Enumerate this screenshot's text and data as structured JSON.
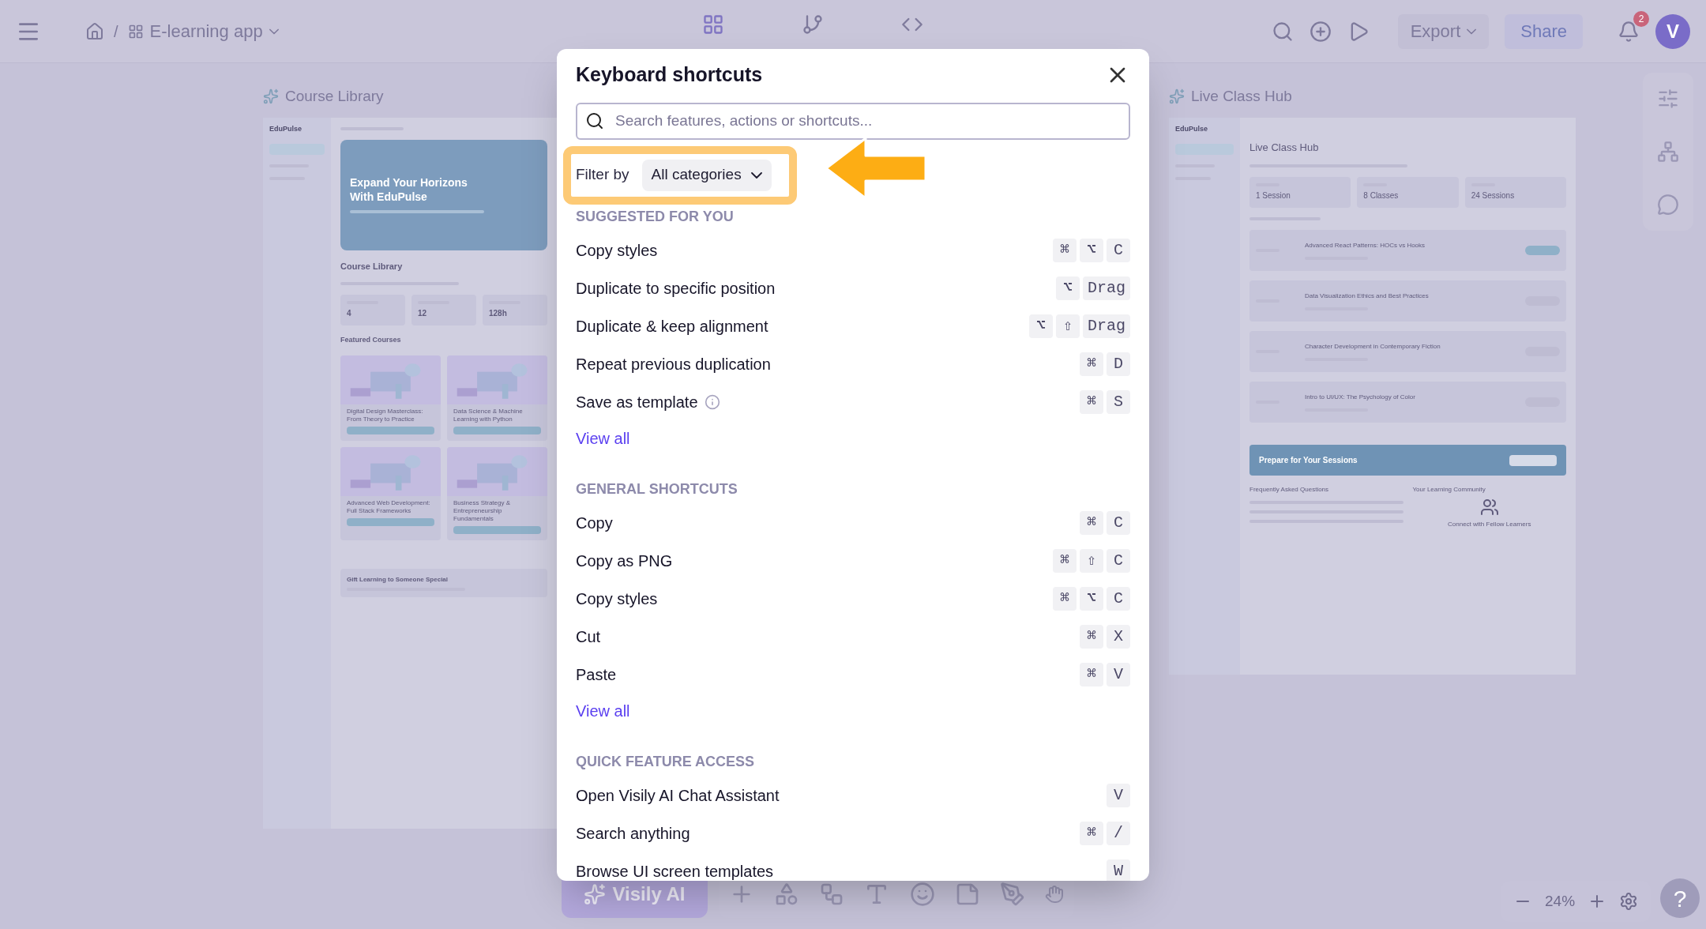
{
  "top_bar": {
    "home_separator": "/",
    "project": "E-learning app",
    "modes": [
      {
        "kind": "design",
        "selected": true
      },
      {
        "kind": "prototype",
        "selected": false
      },
      {
        "kind": "inspect",
        "selected": false
      }
    ],
    "export": "Export",
    "share": "Share",
    "notifications": "2",
    "avatar": "V"
  },
  "course_frame": {
    "title": "Course Library",
    "brand": "EduPulse",
    "hero_title": "Expand Your Horizons With EduPulse",
    "heading": "Course Library",
    "stats": [
      "4",
      "12",
      "128h"
    ],
    "featured": "Featured Courses",
    "courses": [
      "Digital Design Masterclass: From Theory to Practice",
      "Data Science & Machine Learning with Python",
      "Advanced Web Development: Full Stack Frameworks",
      "Business Strategy & Entrepreneurship Fundamentals"
    ],
    "gift_title": "Gift Learning to Someone Special"
  },
  "live_frame": {
    "title": "Live Class Hub",
    "brand": "EduPulse",
    "heading": "Live Class Hub",
    "stats": [
      "1 Session",
      "8 Classes",
      "24 Sessions"
    ],
    "sessions": [
      "Advanced React Patterns: HOCs vs Hooks",
      "Data Visualization Ethics and Best Practices",
      "Character Development in Contemporary Fiction",
      "Intro to UI/UX: The Psychology of Color"
    ],
    "prepare_title": "Prepare for Your Sessions",
    "faq_title": "Frequently Asked Questions",
    "community_title": "Your Learning Community",
    "community_heading": "Connect with Fellow Learners"
  },
  "dialog": {
    "title": "Keyboard shortcuts",
    "search_placeholder": "Search features, actions or shortcuts...",
    "filter_label": "Filter by",
    "filter_value": "All categories",
    "sections": [
      {
        "title": "SUGGESTED FOR YOU",
        "view_all": "View all",
        "rows": [
          {
            "label": "Copy styles",
            "keys": [
              "⌘",
              "⌥",
              "C"
            ],
            "info": false
          },
          {
            "label": "Duplicate to specific position",
            "keys": [
              "⌥",
              "Drag"
            ],
            "info": false
          },
          {
            "label": "Duplicate & keep alignment",
            "keys": [
              "⌥",
              "⇧",
              "Drag"
            ],
            "info": false
          },
          {
            "label": "Repeat previous duplication",
            "keys": [
              "⌘",
              "D"
            ],
            "info": false
          },
          {
            "label": "Save as template",
            "keys": [
              "⌘",
              "S"
            ],
            "info": true
          }
        ]
      },
      {
        "title": "GENERAL SHORTCUTS",
        "view_all": "View all",
        "rows": [
          {
            "label": "Copy",
            "keys": [
              "⌘",
              "C"
            ],
            "info": false
          },
          {
            "label": "Copy as PNG",
            "keys": [
              "⌘",
              "⇧",
              "C"
            ],
            "info": false
          },
          {
            "label": "Copy styles",
            "keys": [
              "⌘",
              "⌥",
              "C"
            ],
            "info": false
          },
          {
            "label": "Cut",
            "keys": [
              "⌘",
              "X"
            ],
            "info": false
          },
          {
            "label": "Paste",
            "keys": [
              "⌘",
              "V"
            ],
            "info": false
          }
        ]
      },
      {
        "title": "QUICK FEATURE ACCESS",
        "rows": [
          {
            "label": "Open Visily AI Chat Assistant",
            "keys": [
              "V"
            ],
            "info": false
          },
          {
            "label": "Search anything",
            "keys": [
              "⌘",
              "/"
            ],
            "info": false
          },
          {
            "label": "Browse UI screen templates",
            "keys": [
              "W"
            ],
            "info": false
          }
        ]
      }
    ]
  },
  "bottom_bar": {
    "ai_button": "Visily AI",
    "zoom": "24%",
    "help": "?"
  }
}
